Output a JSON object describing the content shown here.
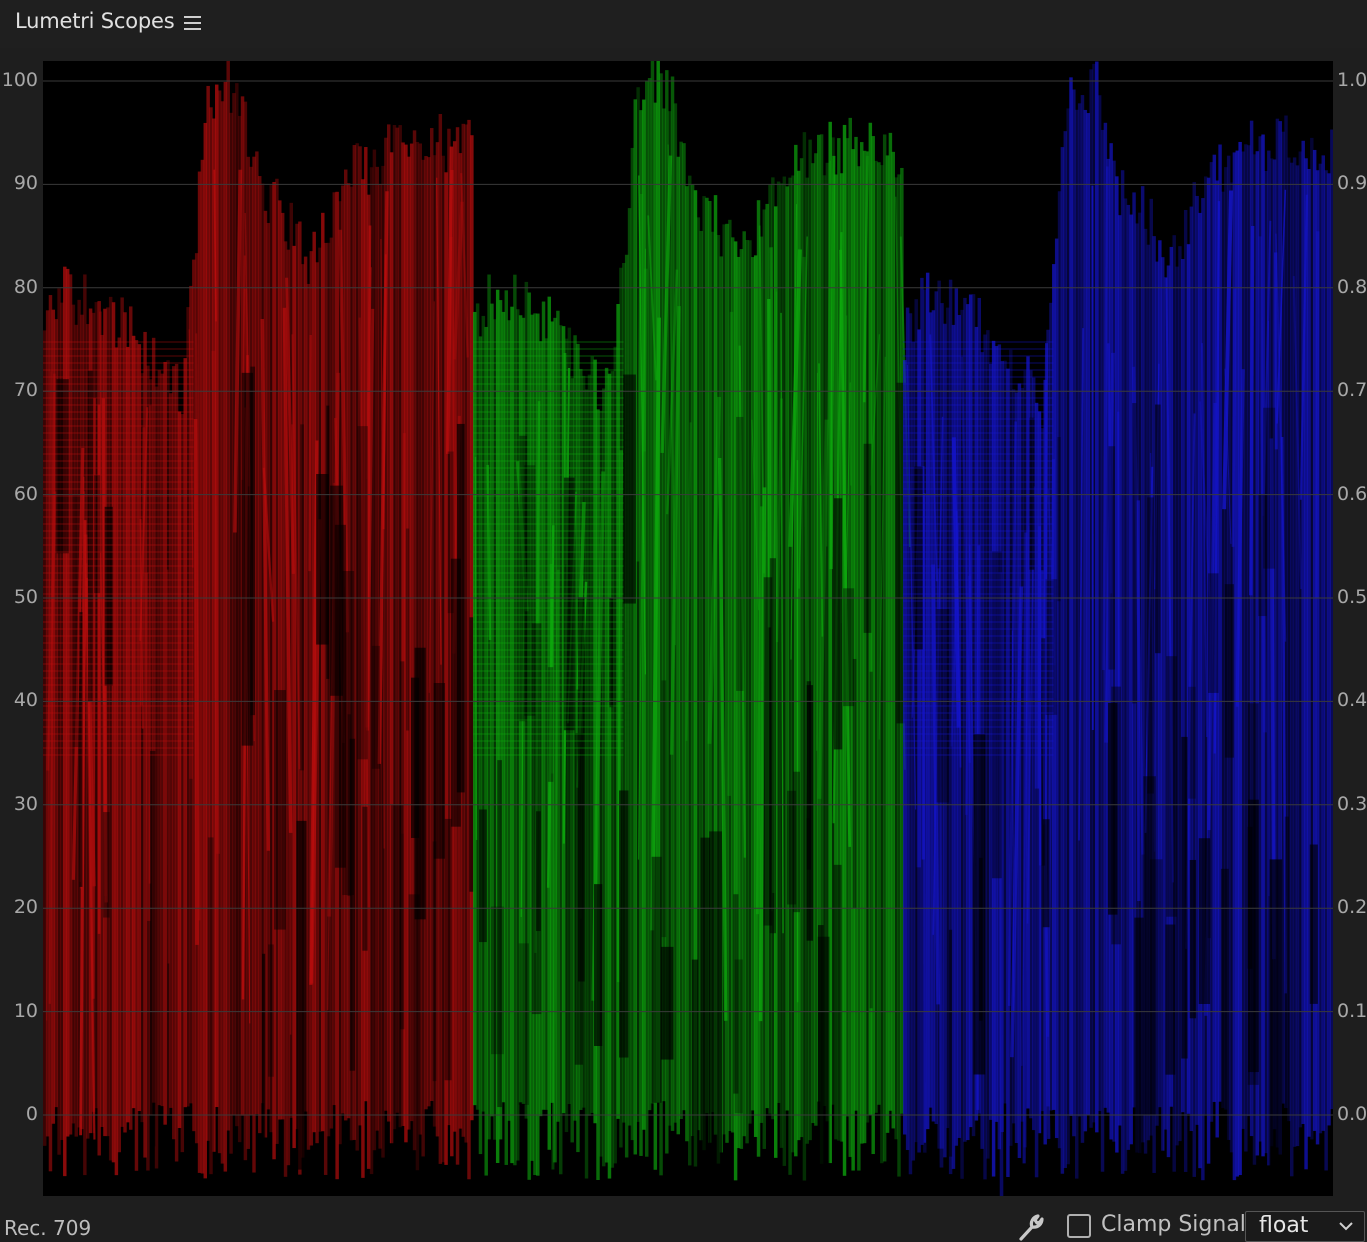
{
  "panel": {
    "title": "Lumetri Scopes",
    "menu_icon": "hamburger-menu-icon"
  },
  "scope": {
    "type": "RGB Parade",
    "channels": [
      {
        "name": "red",
        "color": "#d01010"
      },
      {
        "name": "green",
        "color": "#10c010"
      },
      {
        "name": "blue",
        "color": "#1818e8"
      }
    ],
    "left_scale": [
      "100",
      "90",
      "80",
      "70",
      "60",
      "50",
      "40",
      "30",
      "20",
      "10",
      "0"
    ],
    "right_scale": [
      "1.0",
      "0.9",
      "0.8",
      "0.7",
      "0.6",
      "0.5",
      "0.4",
      "0.3",
      "0.2",
      "0.1",
      "0.0"
    ],
    "gridline_color": "#3a3a3a"
  },
  "footer": {
    "color_standard": "Rec. 709",
    "settings_icon": "wrench-icon",
    "clamp_signal_label": "Clamp Signal",
    "clamp_signal_checked": false,
    "bit_depth": "float"
  }
}
